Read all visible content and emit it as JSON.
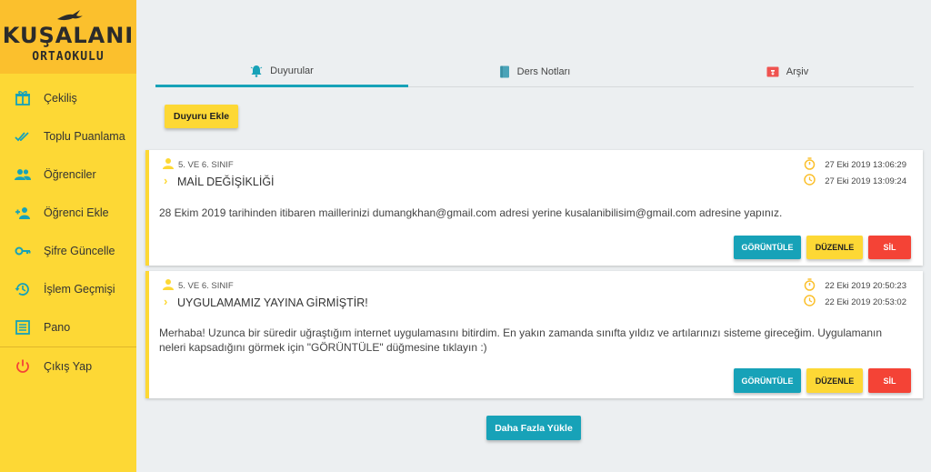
{
  "brand": {
    "name": "KUŞALANI",
    "subtitle": "ORTAOKULU"
  },
  "sidebar": {
    "items": [
      {
        "label": "Çekiliş",
        "icon": "gift-icon"
      },
      {
        "label": "Toplu Puanlama",
        "icon": "double-check-icon"
      },
      {
        "label": "Öğrenciler",
        "icon": "group-icon"
      },
      {
        "label": "Öğrenci Ekle",
        "icon": "person-add-icon"
      },
      {
        "label": "Şifre Güncelle",
        "icon": "key-icon"
      },
      {
        "label": "İşlem Geçmişi",
        "icon": "history-icon"
      },
      {
        "label": "Pano",
        "icon": "list-icon"
      },
      {
        "label": "Çıkış Yap",
        "icon": "power-icon"
      }
    ]
  },
  "tabs": [
    {
      "label": "Duyurular",
      "icon": "bell-icon",
      "active": true
    },
    {
      "label": "Ders Notları",
      "icon": "book-icon",
      "active": false
    },
    {
      "label": "Arşiv",
      "icon": "archive-icon",
      "active": false
    }
  ],
  "actions": {
    "add_label": "Duyuru Ekle",
    "load_more_label": "Daha Fazla Yükle"
  },
  "announcements": [
    {
      "audience": "5. VE 6. SINIF",
      "title": "MAİL DEĞİŞİKLİĞİ",
      "created": "27 Eki 2019 13:06:29",
      "updated": "27 Eki 2019 13:09:24",
      "body": "28 Ekim 2019 tarihinden itibaren maillerinizi dumangkhan@gmail.com adresi yerine kusalanibilisim@gmail.com adresine yapınız.",
      "view_label": "GÖRÜNTÜLE",
      "edit_label": "DÜZENLE",
      "delete_label": "SİL"
    },
    {
      "audience": "5. VE 6. SINIF",
      "title": "UYGULAMAMIZ YAYINA GİRMİŞTİR!",
      "created": "22 Eki 2019 20:50:23",
      "updated": "22 Eki 2019 20:53:02",
      "body": "Merhaba! Uzunca bir süredir uğraştığım internet uygulamasını bitirdim. En yakın zamanda sınıfta yıldız ve artılarınızı sisteme gireceğim. Uygulamanın neleri kapsadığını görmek için \"GÖRÜNTÜLE\" düğmesine tıklayın :)",
      "view_label": "GÖRÜNTÜLE",
      "edit_label": "DÜZENLE",
      "delete_label": "SİL"
    }
  ],
  "colors": {
    "primary": "#fdd835",
    "logo_bg": "#fbc02d",
    "accent": "#17a2b8",
    "danger": "#f44336",
    "icon": "#17a2b8"
  }
}
